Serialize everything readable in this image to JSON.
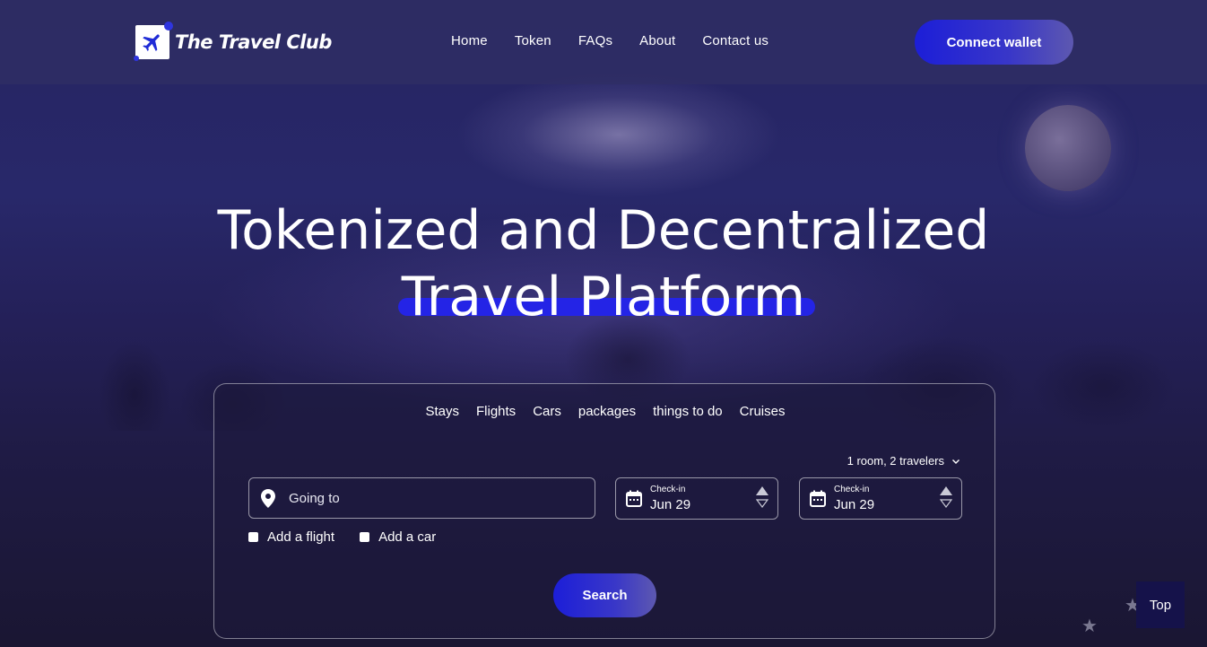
{
  "brand": {
    "name": "The Travel Club",
    "icon": "airplane-icon"
  },
  "nav": {
    "items": [
      "Home",
      "Token",
      "FAQs",
      "About",
      "Contact us"
    ]
  },
  "header": {
    "connect_label": "Connect wallet"
  },
  "hero": {
    "line1": "Tokenized and Decentralized",
    "line2": "Travel Platform"
  },
  "search": {
    "tabs": [
      "Stays",
      "Flights",
      "Cars",
      "packages",
      "things to do",
      "Cruises"
    ],
    "rooms": "1 room, 2 travelers",
    "destination_placeholder": "Going to",
    "checkin1": {
      "label": "Check-in",
      "value": "Jun 29"
    },
    "checkin2": {
      "label": "Check-in",
      "value": "Jun 29"
    },
    "add_flight": "Add a flight",
    "add_car": "Add a car",
    "search_label": "Search"
  },
  "back_to_top": "Top",
  "colors": {
    "accent": "#2424e6",
    "header_bg": "#302e64",
    "top_button": "#15124a"
  }
}
